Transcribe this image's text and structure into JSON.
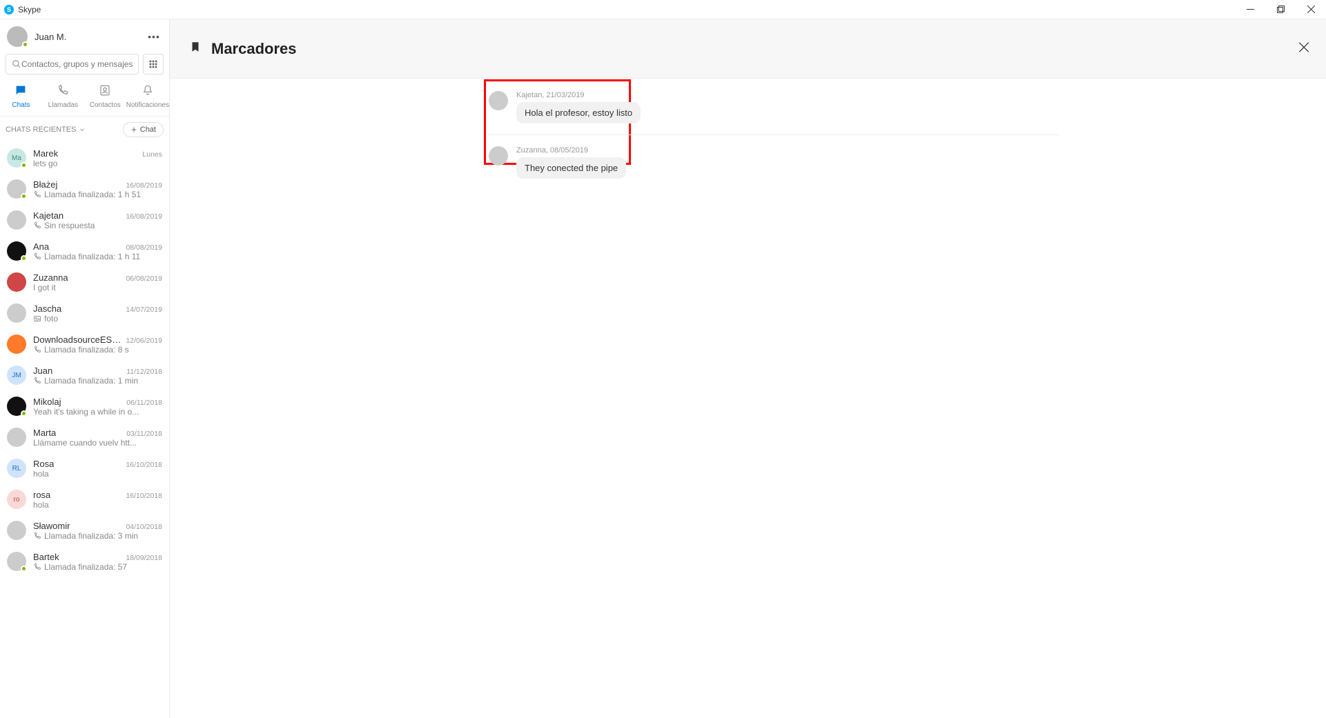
{
  "window": {
    "title": "Skype"
  },
  "user": {
    "name": "Juan M."
  },
  "search": {
    "placeholder": "Contactos, grupos y mensajes"
  },
  "tabs": {
    "chats": "Chats",
    "calls": "Llamadas",
    "contacts": "Contactos",
    "notifications": "Notificaciones"
  },
  "recent": {
    "header": "CHATS RECIENTES",
    "new_chat": "Chat"
  },
  "chats": [
    {
      "name": "Marek",
      "date": "Lunes",
      "preview": "lets go",
      "avatar_text": "Ma",
      "avatar_class": "av-teal",
      "online": true,
      "icon": ""
    },
    {
      "name": "Błażej",
      "date": "16/08/2019",
      "preview": "Llamada finalizada: 1 h 51",
      "avatar_text": "",
      "avatar_class": "",
      "online": true,
      "icon": "call"
    },
    {
      "name": "Kajetan",
      "date": "16/08/2019",
      "preview": "Sin respuesta",
      "avatar_text": "",
      "avatar_class": "",
      "online": false,
      "icon": "call-missed"
    },
    {
      "name": "Ana",
      "date": "08/08/2019",
      "preview": "Llamada finalizada: 1 h 11",
      "avatar_text": "",
      "avatar_class": "av-black",
      "online": true,
      "icon": "call"
    },
    {
      "name": "Zuzanna",
      "date": "06/08/2019",
      "preview": "I got it",
      "avatar_text": "",
      "avatar_class": "av-red",
      "online": false,
      "icon": ""
    },
    {
      "name": "Jascha",
      "date": "14/07/2019",
      "preview": "foto",
      "avatar_text": "",
      "avatar_class": "",
      "online": false,
      "icon": "photo"
    },
    {
      "name": "DownloadsourceES España",
      "date": "12/06/2019",
      "preview": "Llamada finalizada: 8 s",
      "avatar_text": "",
      "avatar_class": "av-orange",
      "online": false,
      "icon": "call"
    },
    {
      "name": "Juan",
      "date": "11/12/2018",
      "preview": "Llamada finalizada: 1 min",
      "avatar_text": "JM",
      "avatar_class": "av-blue",
      "online": false,
      "icon": "call"
    },
    {
      "name": "Mikolaj",
      "date": "06/11/2018",
      "preview": "Yeah it's taking a while in o...",
      "avatar_text": "",
      "avatar_class": "av-black",
      "online": true,
      "icon": ""
    },
    {
      "name": "Marta",
      "date": "03/11/2018",
      "preview": "Llámame cuando vuelv htt...",
      "avatar_text": "",
      "avatar_class": "",
      "online": false,
      "icon": ""
    },
    {
      "name": "Rosa",
      "date": "16/10/2018",
      "preview": "hola",
      "avatar_text": "RL",
      "avatar_class": "av-blue",
      "online": false,
      "icon": ""
    },
    {
      "name": "rosa",
      "date": "16/10/2018",
      "preview": "hola",
      "avatar_text": "ro",
      "avatar_class": "av-pink",
      "online": false,
      "icon": ""
    },
    {
      "name": "Sławomir",
      "date": "04/10/2018",
      "preview": "Llamada finalizada: 3 min",
      "avatar_text": "",
      "avatar_class": "",
      "online": false,
      "icon": "call"
    },
    {
      "name": "Bartek",
      "date": "18/09/2018",
      "preview": "Llamada finalizada: 57",
      "avatar_text": "",
      "avatar_class": "",
      "online": true,
      "icon": "call"
    }
  ],
  "main": {
    "title": "Marcadores"
  },
  "bookmarks": [
    {
      "author": "Kajetan",
      "date": "21/03/2019",
      "text": "Hola el profesor, estoy listo"
    },
    {
      "author": "Zuzanna",
      "date": "08/05/2019",
      "text": "They conected the pipe"
    }
  ]
}
